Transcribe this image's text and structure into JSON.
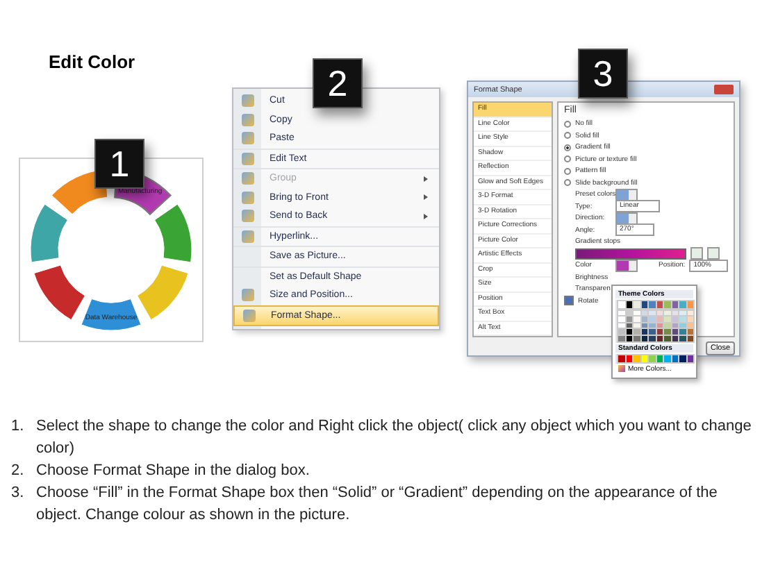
{
  "title": "Edit Color",
  "badges": [
    "1",
    "2",
    "3"
  ],
  "wheel": {
    "segments": [
      {
        "label": "Manufacturing",
        "color": "#b23ab0",
        "selected": true
      },
      {
        "color": "#3aa535",
        "selected": false
      },
      {
        "color": "#e8c21e",
        "selected": false
      },
      {
        "label": "Data Warehouse",
        "color": "#2f8fd6",
        "selected": false
      },
      {
        "color": "#c62a2a",
        "selected": false
      },
      {
        "color": "#3ea6a6",
        "selected": false
      },
      {
        "color": "#f08a1e",
        "selected": false
      }
    ]
  },
  "context_menu": {
    "items": [
      {
        "label": "Cut",
        "disabled": false,
        "submenu": false,
        "selected": false,
        "icon": true,
        "separator": false
      },
      {
        "label": "Copy",
        "disabled": false,
        "submenu": false,
        "selected": false,
        "icon": true,
        "separator": false
      },
      {
        "label": "Paste",
        "disabled": false,
        "submenu": false,
        "selected": false,
        "icon": true,
        "separator": true
      },
      {
        "label": "Edit Text",
        "disabled": false,
        "submenu": false,
        "selected": false,
        "icon": true,
        "separator": true
      },
      {
        "label": "Group",
        "disabled": true,
        "submenu": true,
        "selected": false,
        "icon": true,
        "separator": false
      },
      {
        "label": "Bring to Front",
        "disabled": false,
        "submenu": true,
        "selected": false,
        "icon": true,
        "separator": false
      },
      {
        "label": "Send to Back",
        "disabled": false,
        "submenu": true,
        "selected": false,
        "icon": true,
        "separator": true
      },
      {
        "label": "Hyperlink...",
        "disabled": false,
        "submenu": false,
        "selected": false,
        "icon": true,
        "separator": true
      },
      {
        "label": "Save as Picture...",
        "disabled": false,
        "submenu": false,
        "selected": false,
        "icon": false,
        "separator": true
      },
      {
        "label": "Set as Default Shape",
        "disabled": false,
        "submenu": false,
        "selected": false,
        "icon": false,
        "separator": false
      },
      {
        "label": "Size and Position...",
        "disabled": false,
        "submenu": false,
        "selected": false,
        "icon": true,
        "separator": false
      },
      {
        "label": "Format Shape...",
        "disabled": false,
        "submenu": false,
        "selected": true,
        "icon": true,
        "separator": false
      }
    ]
  },
  "dialog": {
    "title": "Format Shape",
    "categories": [
      {
        "label": "Fill",
        "selected": true
      },
      {
        "label": "Line Color",
        "selected": false
      },
      {
        "label": "Line Style",
        "selected": false
      },
      {
        "label": "Shadow",
        "selected": false
      },
      {
        "label": "Reflection",
        "selected": false
      },
      {
        "label": "Glow and Soft Edges",
        "selected": false
      },
      {
        "label": "3-D Format",
        "selected": false
      },
      {
        "label": "3-D Rotation",
        "selected": false
      },
      {
        "label": "Picture Corrections",
        "selected": false
      },
      {
        "label": "Picture Color",
        "selected": false
      },
      {
        "label": "Artistic Effects",
        "selected": false
      },
      {
        "label": "Crop",
        "selected": false
      },
      {
        "label": "Size",
        "selected": false
      },
      {
        "label": "Position",
        "selected": false
      },
      {
        "label": "Text Box",
        "selected": false
      },
      {
        "label": "Alt Text",
        "selected": false
      }
    ],
    "heading": "Fill",
    "fill_options": [
      {
        "label": "No fill",
        "selected": false
      },
      {
        "label": "Solid fill",
        "selected": false
      },
      {
        "label": "Gradient fill",
        "selected": true
      },
      {
        "label": "Picture or texture fill",
        "selected": false
      },
      {
        "label": "Pattern fill",
        "selected": false
      },
      {
        "label": "Slide background fill",
        "selected": false
      }
    ],
    "preset_label": "Preset colors:",
    "type_label": "Type:",
    "type_value": "Linear",
    "direction_label": "Direction:",
    "angle_label": "Angle:",
    "angle_value": "270°",
    "stops_label": "Gradient stops",
    "color_label": "Color",
    "position_label": "Position:",
    "position_value": "100%",
    "brightness_label": "Brightness",
    "transparency_label": "Transparen",
    "rotate": {
      "label": "Rotate",
      "checked": true
    },
    "close_button": "Close",
    "color_popup": {
      "theme_label": "Theme Colors",
      "theme_colors": [
        {
          "color": "#ffffff"
        },
        {
          "color": "#000000"
        },
        {
          "color": "#eeece1"
        },
        {
          "color": "#1f497d"
        },
        {
          "color": "#4f81bd"
        },
        {
          "color": "#c0504d"
        },
        {
          "color": "#9bbb59"
        },
        {
          "color": "#8064a2"
        },
        {
          "color": "#4bacc6"
        },
        {
          "color": "#f79646"
        }
      ],
      "standard_label": "Standard Colors",
      "standard_colors": [
        {
          "color": "#c00000"
        },
        {
          "color": "#ff0000"
        },
        {
          "color": "#ffc000"
        },
        {
          "color": "#ffff00"
        },
        {
          "color": "#92d050"
        },
        {
          "color": "#00b050"
        },
        {
          "color": "#00b0f0"
        },
        {
          "color": "#0070c0"
        },
        {
          "color": "#002060"
        },
        {
          "color": "#7030a0"
        }
      ],
      "more_label": "More Colors..."
    }
  },
  "instructions": [
    {
      "number": "1.",
      "text": "Select the shape to change the color and Right click the object( click any object which you want to change color)"
    },
    {
      "number": "2.",
      "text": "Choose Format Shape in the dialog box."
    },
    {
      "number": "3.",
      "text": "Choose “Fill” in the Format Shape box then “Solid” or “Gradient” depending on the appearance of the object. Change colour as shown in the picture."
    }
  ]
}
